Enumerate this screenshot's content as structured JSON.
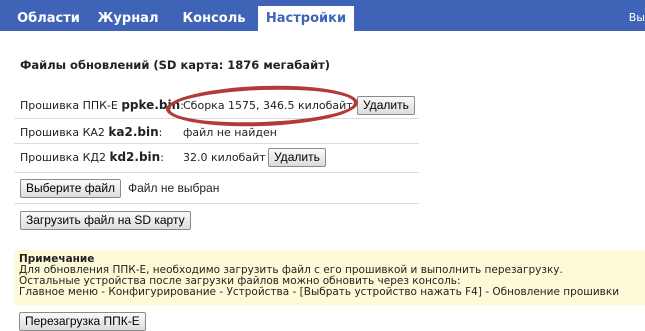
{
  "nav": {
    "tabs": [
      {
        "label": "Области"
      },
      {
        "label": "Журнал"
      },
      {
        "label": "Консоль"
      },
      {
        "label": "Настройки"
      }
    ],
    "active_tab": "Настройки",
    "right_text": "Вы"
  },
  "section": {
    "title": "Файлы обновлений (SD карта: 1876 мегабайт)"
  },
  "files": [
    {
      "label_prefix": "Прошивка ППК-Е ",
      "filename": "ppke.bin",
      "label_suffix": ":",
      "status": "Сборка 1575, 346.5 килобайт",
      "action": "Удалить"
    },
    {
      "label_prefix": "Прошивка КА2 ",
      "filename": "ka2.bin",
      "label_suffix": ":",
      "status": "файл не найден",
      "action": ""
    },
    {
      "label_prefix": "Прошивка КД2 ",
      "filename": "kd2.bin",
      "label_suffix": ":",
      "status": "32.0 килобайт",
      "action": "Удалить"
    }
  ],
  "upload": {
    "choose_label": "Выберите файл",
    "no_file_text": "Файл не выбран",
    "upload_label": "Загрузить файл на SD карту"
  },
  "note": {
    "title": "Примечание",
    "lines": [
      "Для обновления ППК-Е, необходимо загрузить файл с его прошивкой и выполнить перезагрузку.",
      "Остальные устройства после загрузки файлов можно обновить через консоль:",
      "Главное меню - Конфигурирование - Устройства - [Выбрать устройство нажать F4] - Обновление прошивки"
    ]
  },
  "reboot_label": "Перезагрузка ППК-Е",
  "colors": {
    "nav_bg": "#3f64b7",
    "note_bg": "#fefad8",
    "highlight_ellipse": "#b33a3a"
  }
}
